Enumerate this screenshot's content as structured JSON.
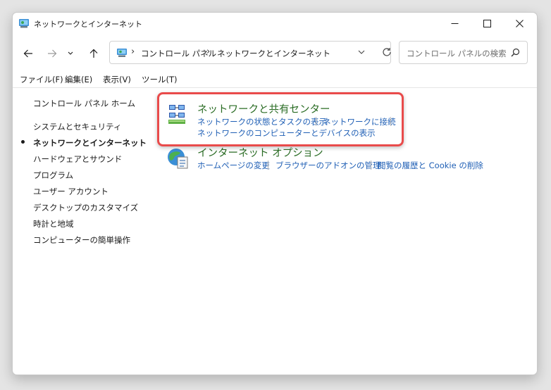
{
  "window": {
    "title": "ネットワークとインターネット"
  },
  "address": {
    "crumbs": [
      "コントロール パネル",
      "ネットワークとインターネット"
    ]
  },
  "search": {
    "placeholder": "コントロール パネルの検索"
  },
  "menu": {
    "items": [
      "ファイル(F)",
      "編集(E)",
      "表示(V)",
      "ツール(T)"
    ]
  },
  "sidebar": {
    "home": "コントロール パネル ホーム",
    "items": [
      "システムとセキュリティ",
      "ネットワークとインターネット",
      "ハードウェアとサウンド",
      "プログラム",
      "ユーザー アカウント",
      "デスクトップのカスタマイズ",
      "時計と地域",
      "コンピューターの簡単操作"
    ],
    "active_index": 1
  },
  "content": {
    "categories": [
      {
        "title": "ネットワークと共有センター",
        "icon": "network-sharing-center-icon",
        "links": [
          "ネットワークの状態とタスクの表示",
          "ネットワークに接続",
          "ネットワークのコンピューターとデバイスの表示"
        ]
      },
      {
        "title": "インターネット オプション",
        "icon": "internet-options-icon",
        "links": [
          "ホームページの変更",
          "ブラウザーのアドオンの管理",
          "閲覧の履歴と Cookie の削除"
        ]
      }
    ]
  },
  "colors": {
    "category_title": "#2a6c24",
    "link": "#1f5fb5",
    "highlight": "#e94b4b"
  }
}
